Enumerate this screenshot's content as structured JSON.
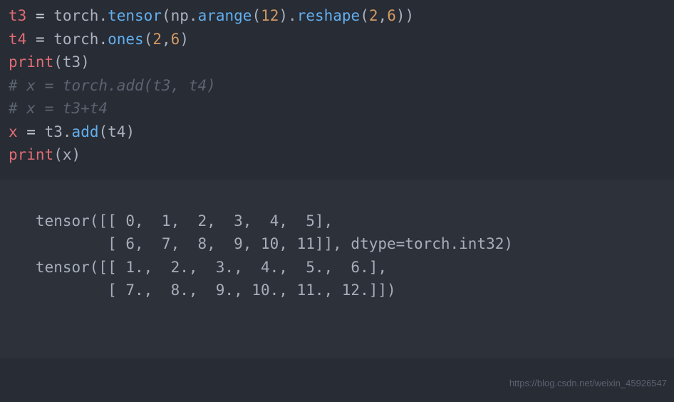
{
  "code": {
    "line1": {
      "t3": "t3",
      "eq": " = ",
      "torch": "torch",
      "dot1": ".",
      "tensor": "tensor",
      "op1": "(",
      "np": "np",
      "dot2": ".",
      "arange": "arange",
      "op2": "(",
      "twelve": "12",
      "cp2": ")",
      "dot3": ".",
      "reshape": "reshape",
      "op3": "(",
      "two": "2",
      "comma": ",",
      "six": "6",
      "cp3": "))"
    },
    "line2": {
      "t4": "t4",
      "eq": " = ",
      "torch": "torch",
      "dot": ".",
      "ones": "ones",
      "op": "(",
      "two": "2",
      "comma": ",",
      "six": "6",
      "cp": ")"
    },
    "line3": {
      "print": "print",
      "op": "(",
      "t3": "t3",
      "cp": ")"
    },
    "line4": "# x = torch.add(t3, t4)",
    "line5": "# x = t3+t4",
    "line6": {
      "x": "x",
      "eq": " = ",
      "t3": "t3",
      "dot": ".",
      "add": "add",
      "op": "(",
      "t4": "t4",
      "cp": ")"
    },
    "line7": {
      "print": "print",
      "op": "(",
      "x": "x",
      "cp": ")"
    }
  },
  "output": {
    "l1": "   tensor([[ 0,  1,  2,  3,  4,  5],",
    "l2": "           [ 6,  7,  8,  9, 10, 11]], dtype=torch.int32)",
    "l3": "   tensor([[ 1.,  2.,  3.,  4.,  5.,  6.],",
    "l4": "           [ 7.,  8.,  9., 10., 11., 12.]])"
  },
  "watermark": "https://blog.csdn.net/weixin_45926547",
  "chart_data": {
    "type": "table",
    "t3_values": [
      [
        0,
        1,
        2,
        3,
        4,
        5
      ],
      [
        6,
        7,
        8,
        9,
        10,
        11
      ]
    ],
    "t3_dtype": "torch.int32",
    "x_values": [
      [
        1.0,
        2.0,
        3.0,
        4.0,
        5.0,
        6.0
      ],
      [
        7.0,
        8.0,
        9.0,
        10.0,
        11.0,
        12.0
      ]
    ]
  }
}
